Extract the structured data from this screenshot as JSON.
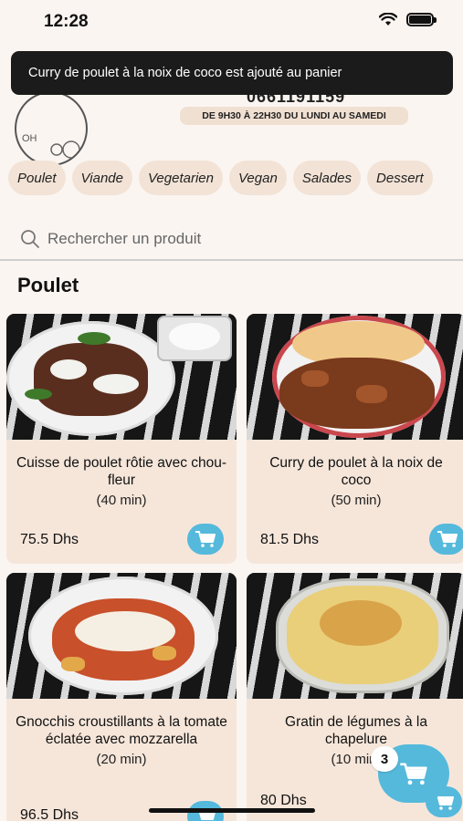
{
  "status_bar": {
    "time": "12:28"
  },
  "toast": {
    "message": "Curry de poulet à la noix de coco est ajouté au panier"
  },
  "header": {
    "phone": "0661191159",
    "hours": "DE 9H30 À 22H30 DU LUNDI AU SAMEDI"
  },
  "categories": [
    "Poulet",
    "Viande",
    "Vegetarien",
    "Vegan",
    "Salades",
    "Dessert"
  ],
  "search": {
    "placeholder": "Rechercher un produit"
  },
  "section": {
    "title": "Poulet"
  },
  "products": [
    {
      "title": "Cuisse de poulet rôtie avec chou-fleur",
      "time": "(40 min)",
      "price": "75.5 Dhs"
    },
    {
      "title": "Curry de poulet à la noix de coco",
      "time": "(50 min)",
      "price": "81.5 Dhs"
    },
    {
      "title": "Gnocchis croustillants à la tomate éclatée avec mozzarella",
      "time": "(20 min)",
      "price": "96.5 Dhs"
    },
    {
      "title": "Gratin de légumes à la chapelure",
      "time": "(10 min)",
      "price": "80 Dhs"
    }
  ],
  "cart": {
    "count": "3"
  },
  "colors": {
    "accent": "#55b9dc",
    "card": "#f6e6da",
    "chip": "#f2e3d6",
    "background": "#fbf5f1",
    "toast": "#1b1b1b"
  }
}
